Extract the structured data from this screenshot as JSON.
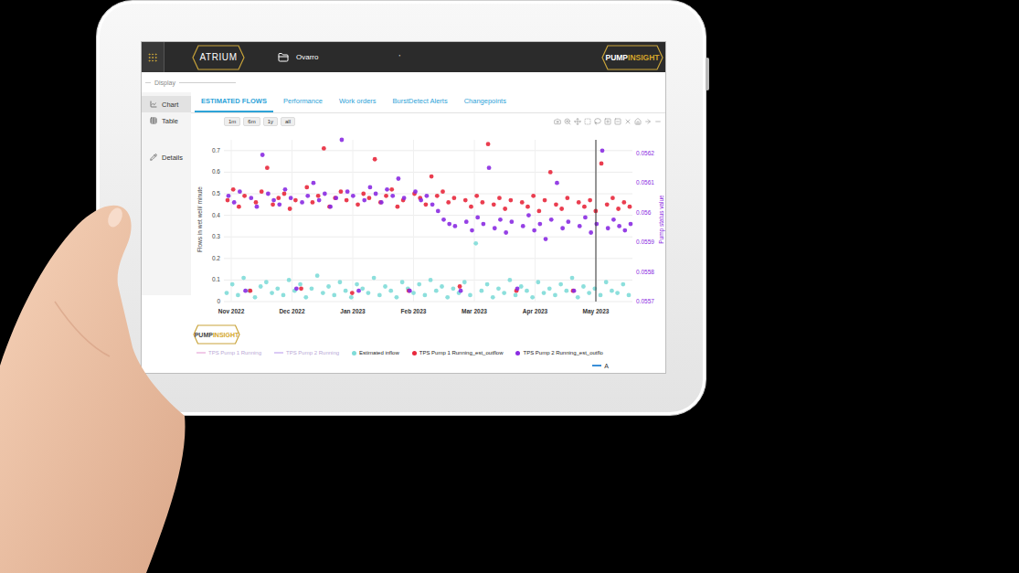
{
  "topbar": {
    "brand": "ATRIUM",
    "workspace": "Ovarro",
    "mark": "'",
    "product": {
      "part1": "PUMP",
      "part2": "INSIGHT"
    }
  },
  "display_label": "Display",
  "sidebar": {
    "items": [
      {
        "label": "Chart",
        "selected": true
      },
      {
        "label": "Table",
        "selected": false
      },
      {
        "label": "Details",
        "selected": false
      }
    ]
  },
  "tabs": [
    {
      "label": "ESTIMATED FLOWS",
      "selected": true
    },
    {
      "label": "Performance",
      "selected": false
    },
    {
      "label": "Work orders",
      "selected": false
    },
    {
      "label": "BurstDetect Alerts",
      "selected": false
    },
    {
      "label": "Changepoints",
      "selected": false
    }
  ],
  "ranges": [
    {
      "label": "1m",
      "selected": false
    },
    {
      "label": "6m",
      "selected": false
    },
    {
      "label": "1y",
      "selected": false
    },
    {
      "label": "all",
      "selected": false
    }
  ],
  "chart": {
    "y_axis": {
      "title": "Flows in wet well/ minute",
      "ticks": [
        "0",
        "0.1",
        "0.2",
        "0.3",
        "0.4",
        "0.5",
        "0.6",
        "0.7"
      ]
    },
    "y2_axis": {
      "title": "Pump status value",
      "ticks": [
        "0.0562",
        "0.0561",
        "0.056",
        "0.0559",
        "0.0558",
        "0.0557"
      ]
    },
    "x_axis": {
      "ticks": [
        "Nov 2022",
        "Dec 2022",
        "Jan 2023",
        "Feb 2023",
        "Mar 2023",
        "Apr 2023",
        "May 2023"
      ]
    },
    "hover_line": {
      "visible": true
    },
    "series": [
      {
        "name": "Estimated inflow",
        "color": "#7fdcd8",
        "values": [
          0.04,
          0.08,
          0.03,
          0.11,
          0.05,
          0.02,
          0.07,
          0.09,
          0.04,
          0.06,
          0.03,
          0.1,
          0.05,
          0.08,
          0.02,
          0.06,
          0.12,
          0.04,
          0.07,
          0.03,
          0.09,
          0.05,
          0.02,
          0.08,
          0.06,
          0.04,
          0.11,
          0.03,
          0.07,
          0.05,
          0.02,
          0.09,
          0.06,
          0.04,
          0.08,
          0.03,
          0.1,
          0.05,
          0.07,
          0.02,
          0.06,
          0.04,
          0.09,
          0.03,
          0.27,
          0.05,
          0.08,
          0.02,
          0.06,
          0.04,
          0.1,
          0.03,
          0.07,
          0.05,
          0.02,
          0.09,
          0.04,
          0.06,
          0.03,
          0.08,
          0.05,
          0.11,
          0.02,
          0.07,
          0.04,
          0.06,
          0.03,
          0.09,
          0.05,
          0.04,
          0.08,
          0.03
        ]
      },
      {
        "name": "TPS Pump 1 Running_est_outflow",
        "color": "#e8283c",
        "values": [
          0.47,
          0.52,
          0.44,
          0.49,
          0.05,
          0.46,
          0.51,
          0.62,
          0.45,
          0.48,
          0.5,
          0.43,
          0.47,
          0.06,
          0.53,
          0.46,
          0.49,
          0.71,
          0.44,
          0.48,
          0.51,
          0.47,
          0.04,
          0.45,
          0.5,
          0.48,
          0.66,
          0.46,
          0.49,
          0.52,
          0.44,
          0.47,
          0.05,
          0.5,
          0.48,
          0.45,
          0.58,
          0.49,
          0.51,
          0.46,
          0.48,
          0.07,
          0.47,
          0.44,
          0.49,
          0.46,
          0.73,
          0.45,
          0.48,
          0.43,
          0.47,
          0.05,
          0.46,
          0.44,
          0.49,
          0.42,
          0.47,
          0.6,
          0.45,
          0.43,
          0.48,
          0.05,
          0.46,
          0.44,
          0.47,
          0.42,
          0.64,
          0.45,
          0.48,
          0.43,
          0.46,
          0.44
        ]
      },
      {
        "name": "TPS Pump 2 Running_est_outflow",
        "color": "#8a2be2",
        "values": [
          0.49,
          0.46,
          0.51,
          0.05,
          0.48,
          0.44,
          0.68,
          0.5,
          0.47,
          0.45,
          0.52,
          0.48,
          0.06,
          0.46,
          0.49,
          0.55,
          0.47,
          0.5,
          0.44,
          0.48,
          0.75,
          0.51,
          0.49,
          0.05,
          0.47,
          0.53,
          0.5,
          0.46,
          0.52,
          0.49,
          0.57,
          0.48,
          0.05,
          0.51,
          0.47,
          0.49,
          0.45,
          0.42,
          0.38,
          0.36,
          0.35,
          0.05,
          0.37,
          0.33,
          0.39,
          0.36,
          0.62,
          0.34,
          0.38,
          0.32,
          0.37,
          0.06,
          0.35,
          0.4,
          0.33,
          0.36,
          0.29,
          0.38,
          0.55,
          0.34,
          0.37,
          0.05,
          0.35,
          0.39,
          0.32,
          0.36,
          0.7,
          0.34,
          0.38,
          0.35,
          0.33,
          0.36
        ]
      }
    ]
  },
  "chart_logo": {
    "part1": "PUMP",
    "part2": "INSIGHT"
  },
  "legend": [
    {
      "label": "TPS Pump 1 Running",
      "color": "#e8a6d8",
      "kind": "line",
      "hidden": true
    },
    {
      "label": "TPS Pump 2 Running",
      "color": "#c3a7ef",
      "kind": "line",
      "hidden": true
    },
    {
      "label": "Estimated inflow",
      "color": "#7fdcd8",
      "kind": "dot",
      "hidden": false
    },
    {
      "label": "TPS Pump 1 Running_est_outflow",
      "color": "#e8283c",
      "kind": "dot",
      "hidden": false
    },
    {
      "label": "TPS Pump 2 Running_est_outflo",
      "color": "#8a2be2",
      "kind": "dot",
      "hidden": false
    }
  ],
  "extra_legend": {
    "label": "A",
    "color": "#3a8fd8"
  }
}
